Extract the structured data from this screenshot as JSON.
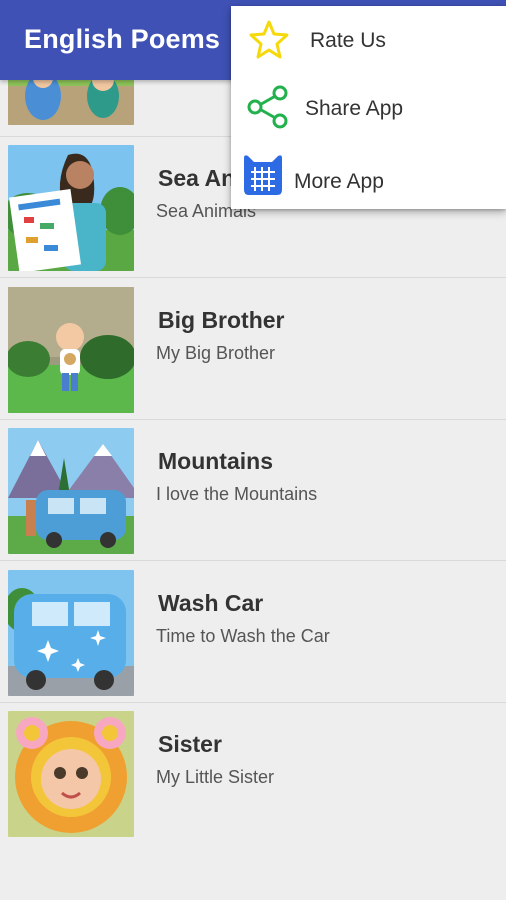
{
  "app_title": "English Poems",
  "menu": {
    "items": [
      {
        "label": "Rate Us",
        "icon": "star-icon"
      },
      {
        "label": "Share App",
        "icon": "share-icon"
      },
      {
        "label": "More App",
        "icon": "grid-app-icon"
      }
    ]
  },
  "poems": [
    {
      "title": "",
      "subtitle": ""
    },
    {
      "title": "Sea Animals",
      "subtitle": "Sea Animals"
    },
    {
      "title": "Big Brother",
      "subtitle": "My Big Brother"
    },
    {
      "title": "Mountains",
      "subtitle": "I love the Mountains"
    },
    {
      "title": "Wash Car",
      "subtitle": "Time to Wash the Car"
    },
    {
      "title": "Sister",
      "subtitle": "My Little Sister"
    }
  ],
  "colors": {
    "app_bar": "#3f51b5",
    "star": "#f5d90a",
    "share": "#22b14c",
    "more_app": "#2d6be4"
  }
}
